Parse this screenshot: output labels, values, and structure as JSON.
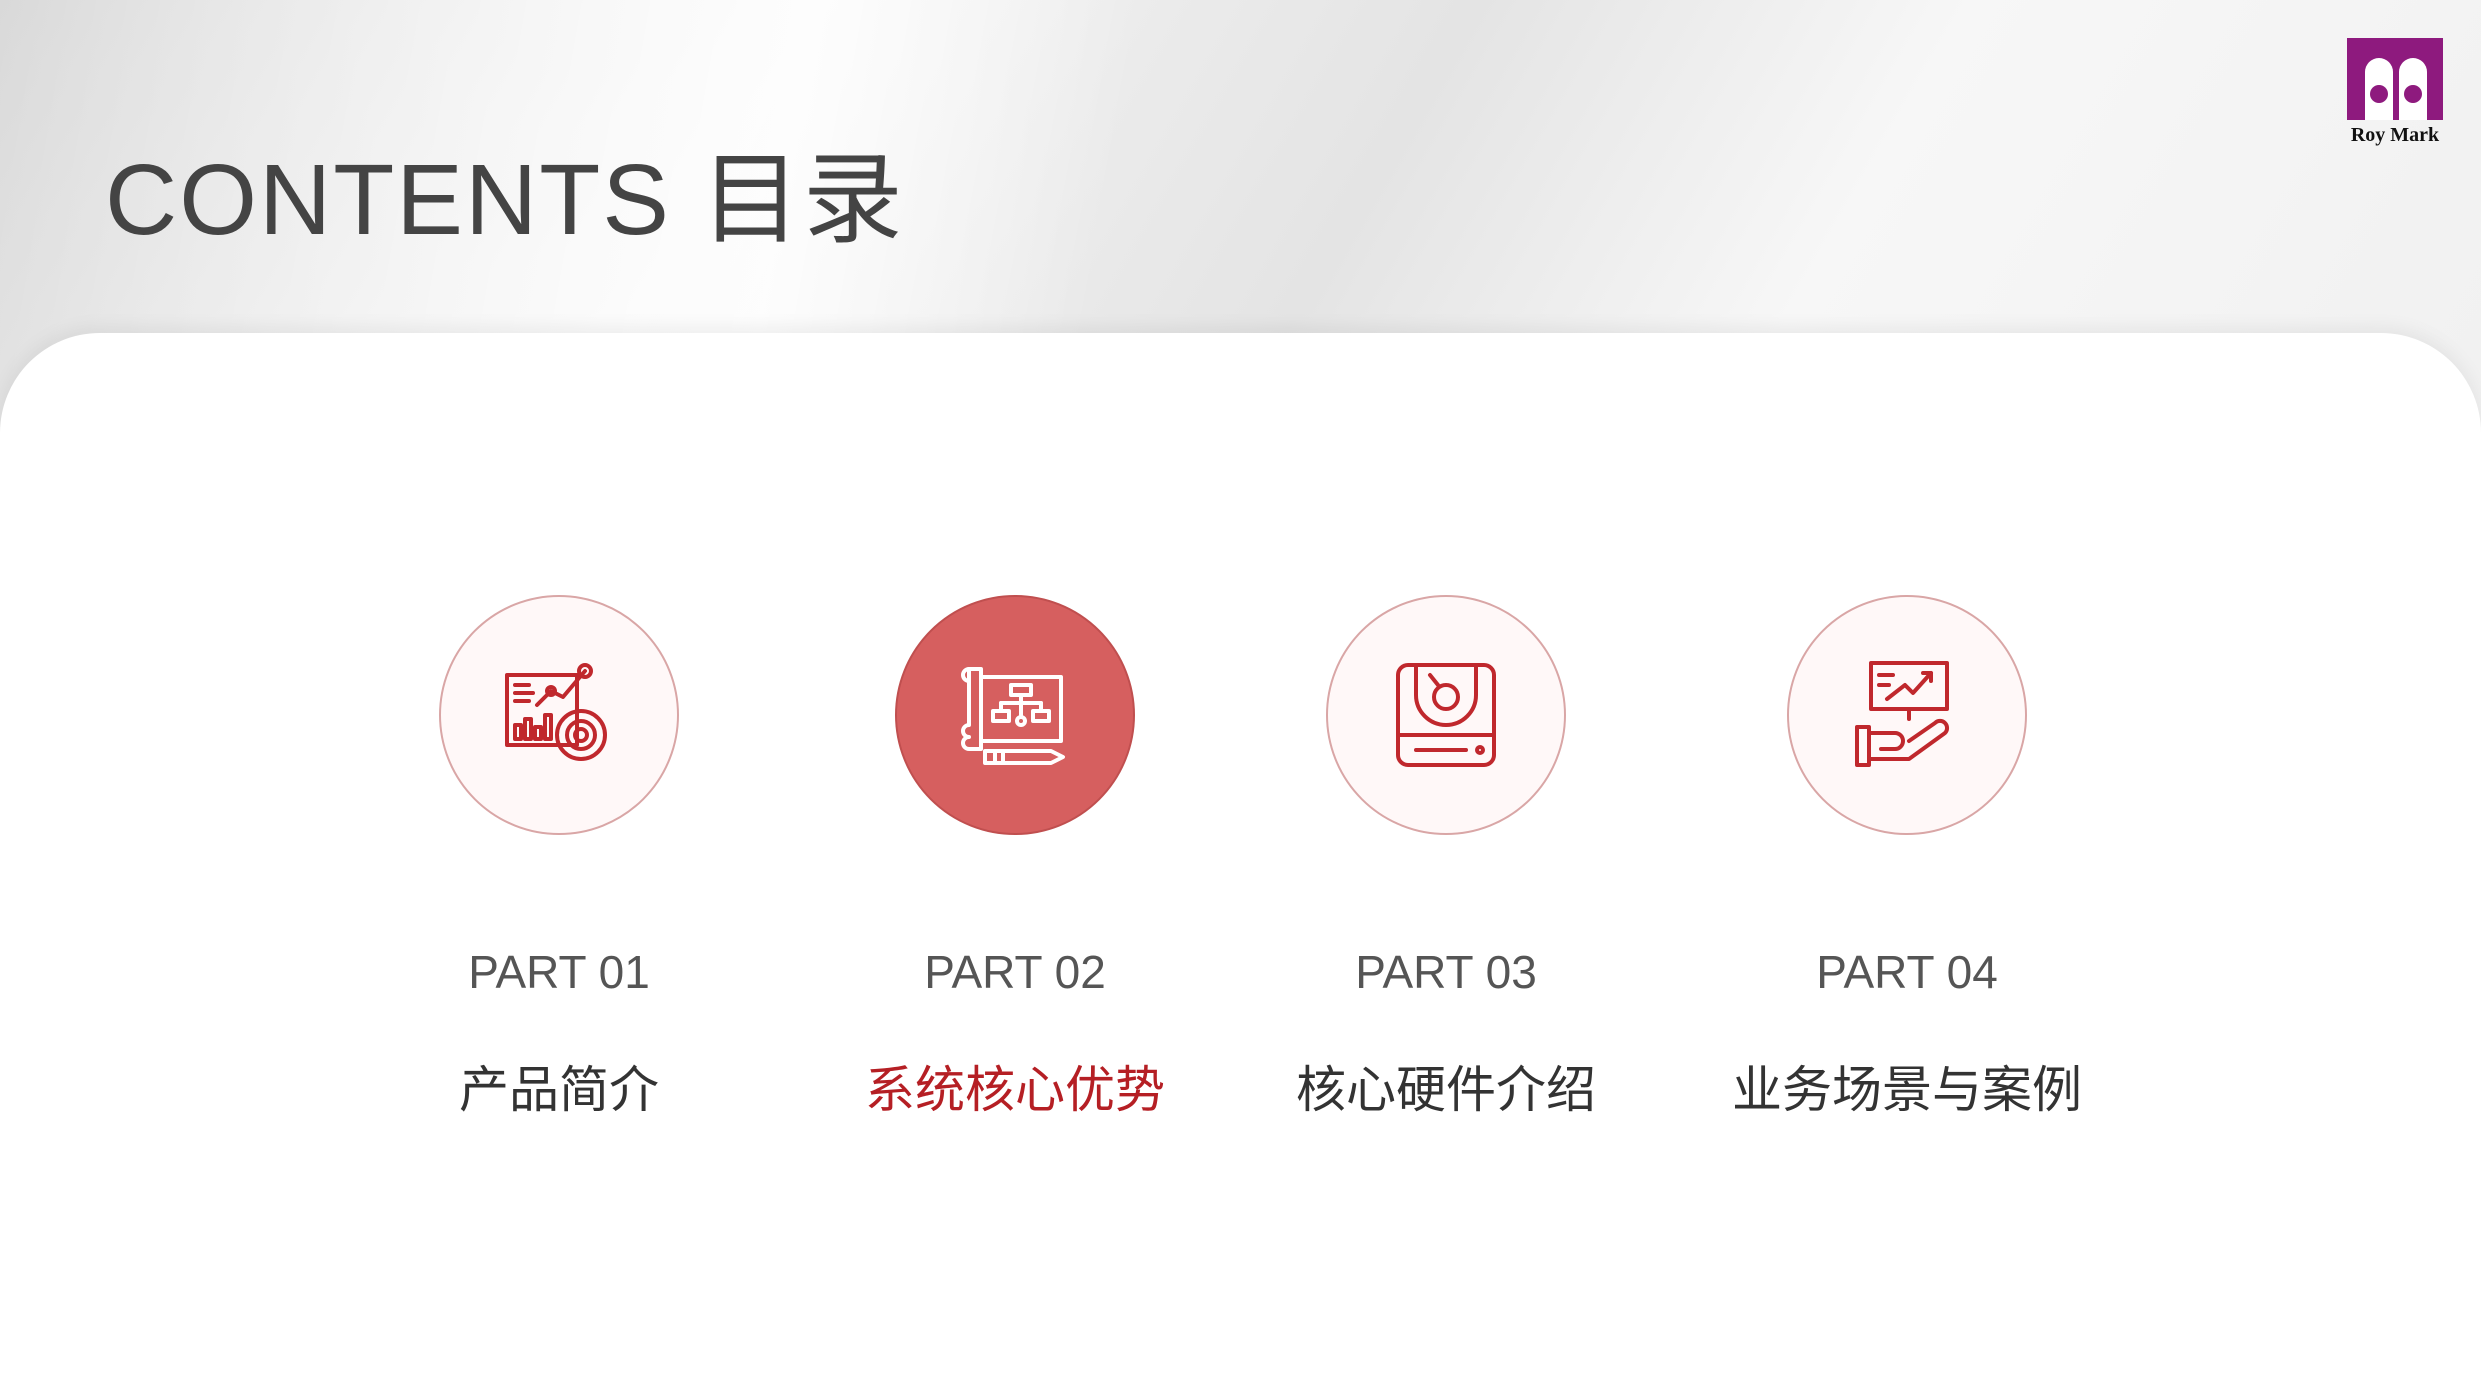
{
  "header": {
    "title": "CONTENTS  目录",
    "logo_text": "Roy Mark"
  },
  "colors": {
    "accent": "#b51f24",
    "active_circle": "#d65f5f",
    "logo": "#8e1a7e"
  },
  "sections": [
    {
      "part": "PART 01",
      "label": "产品简介",
      "icon": "analytics-dashboard-icon",
      "active": false
    },
    {
      "part": "PART 02",
      "label": "系统核心优势",
      "icon": "blueprint-flowchart-icon",
      "active": true
    },
    {
      "part": "PART 03",
      "label": "核心硬件介绍",
      "icon": "hardware-device-icon",
      "active": false
    },
    {
      "part": "PART 04",
      "label": "业务场景与案例",
      "icon": "hand-presentation-icon",
      "active": false
    }
  ]
}
